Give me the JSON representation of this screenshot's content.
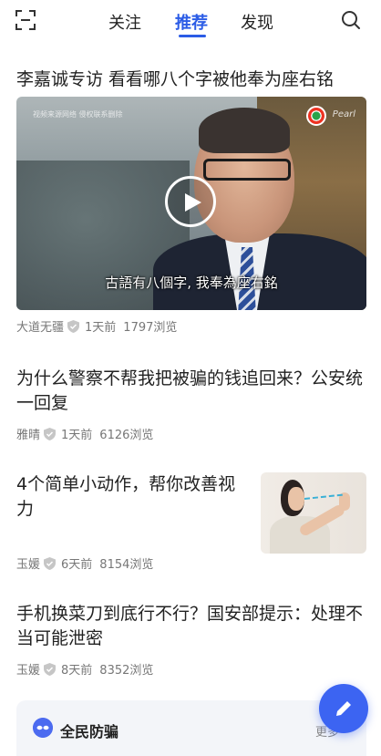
{
  "nav": {
    "tabs": [
      {
        "label": "关注"
      },
      {
        "label": "推荐",
        "active": true
      },
      {
        "label": "发现"
      }
    ],
    "left_icon": "scan-icon",
    "right_icon": "search-icon",
    "accent_color": "#2b5ce6"
  },
  "feed": [
    {
      "title": "李嘉诚专访 看看哪八个字被他奉为座右铭",
      "media": "video",
      "video_watermark": "视频来源网络 侵权联系删除",
      "video_subtitle": "古語有八個字, 我奉為座右銘",
      "author": "大道无疆",
      "time": "1天前",
      "views": "1797浏览"
    },
    {
      "title": "为什么警察不帮我把被骗的钱追回来？公安统一回复",
      "author": "雅晴",
      "time": "1天前",
      "views": "6126浏览"
    },
    {
      "title": "4个简单小动作，帮你改善视力",
      "media": "thumbnail",
      "author": "玉媛",
      "time": "6天前",
      "views": "8154浏览"
    },
    {
      "title": "手机换菜刀到底行不行？国安部提示：处理不当可能泄密",
      "author": "玉媛",
      "time": "8天前",
      "views": "8352浏览"
    }
  ],
  "card": {
    "title": "全民防骗",
    "more": "更多",
    "icon": "mask-icon"
  },
  "fab": {
    "icon": "edit-icon",
    "color": "#3c64f2"
  }
}
